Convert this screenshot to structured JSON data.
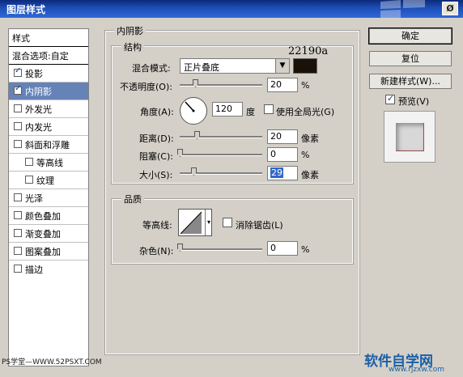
{
  "window": {
    "title": "图层样式",
    "close_symbol": "Ø"
  },
  "left_list": {
    "header": "样式",
    "blend_options": "混合选项:自定",
    "items": [
      {
        "label": "投影",
        "checked": true
      },
      {
        "label": "内阴影",
        "checked": true,
        "selected": true
      },
      {
        "label": "外发光",
        "checked": false
      },
      {
        "label": "内发光",
        "checked": false
      },
      {
        "label": "斜面和浮雕",
        "checked": false
      },
      {
        "label": "等高线",
        "checked": false
      },
      {
        "label": "纹理",
        "checked": false
      },
      {
        "label": "光泽",
        "checked": false
      },
      {
        "label": "颜色叠加",
        "checked": false
      },
      {
        "label": "渐变叠加",
        "checked": false
      },
      {
        "label": "图案叠加",
        "checked": false
      },
      {
        "label": "描边",
        "checked": false
      }
    ]
  },
  "section": {
    "title": "内阴影",
    "structure": {
      "title": "结构",
      "blend_mode_label": "混合模式:",
      "blend_mode_value": "正片叠底",
      "color_code": "22190a",
      "color_hex": "#22190a",
      "opacity_label": "不透明度(O):",
      "opacity_value": "20",
      "opacity_unit": "%",
      "angle_label": "角度(A):",
      "angle_value": "120",
      "angle_unit": "度",
      "global_light_label": "使用全局光(G)",
      "global_light_checked": false,
      "distance_label": "距离(D):",
      "distance_value": "20",
      "distance_unit": "像素",
      "choke_label": "阻塞(C):",
      "choke_value": "0",
      "choke_unit": "%",
      "size_label": "大小(S):",
      "size_value": "29",
      "size_unit": "像素"
    },
    "quality": {
      "title": "品质",
      "contour_label": "等高线:",
      "antialias_label": "消除锯齿(L)",
      "antialias_checked": false,
      "noise_label": "杂色(N):",
      "noise_value": "0",
      "noise_unit": "%"
    }
  },
  "buttons": {
    "ok": "确定",
    "reset": "复位",
    "new_style": "新建样式(W)...",
    "preview_label": "预览(V)",
    "preview_checked": true
  },
  "watermarks": {
    "left": "PS学堂—WWW.52PSXT.COM",
    "right": "软件自学网",
    "right_url": "www.rjzxw.com"
  },
  "colors": {
    "titlebar": "#1d4fb8",
    "selection": "#6683b7",
    "dialog_bg": "#d4d0c8"
  }
}
